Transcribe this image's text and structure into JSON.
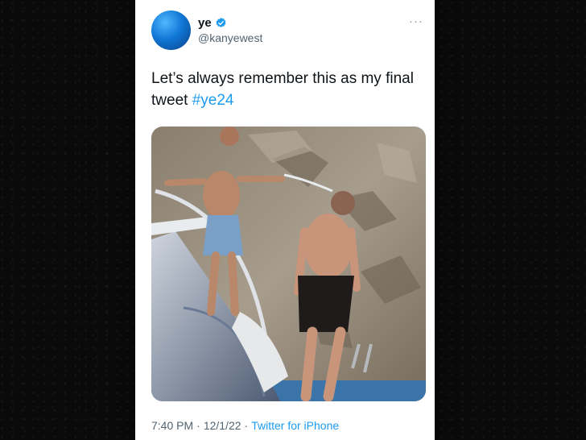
{
  "tweet": {
    "display_name": "ye",
    "handle": "@kanyewest",
    "more_glyph": "···",
    "text": "Let’s always remember this as my final tweet ",
    "hashtag": "#ye24",
    "time": "7:40 PM",
    "separator": "·",
    "date": "12/1/22",
    "source": "Twitter for iPhone"
  },
  "colors": {
    "link": "#1d9bf0",
    "verified": "#1d9bf0",
    "avatar": "#1078d6"
  },
  "icons": [
    "verified-badge-icon",
    "more-options-icon"
  ]
}
